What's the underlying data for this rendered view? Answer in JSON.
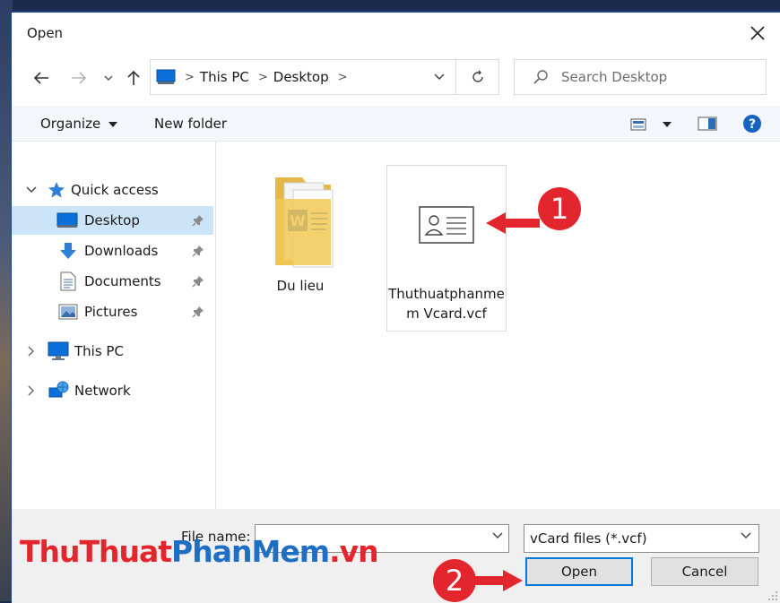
{
  "window": {
    "title": "Open"
  },
  "address": {
    "segments": [
      "This PC",
      "Desktop"
    ]
  },
  "search": {
    "placeholder": "Search Desktop"
  },
  "toolbar": {
    "organize_label": "Organize",
    "new_folder_label": "New folder"
  },
  "sidebar": {
    "quick_access_label": "Quick access",
    "items": [
      {
        "label": "Desktop",
        "icon": "desktop-icon",
        "selected": true
      },
      {
        "label": "Downloads",
        "icon": "download-icon"
      },
      {
        "label": "Documents",
        "icon": "documents-icon"
      },
      {
        "label": "Pictures",
        "icon": "pictures-icon"
      }
    ],
    "this_pc_label": "This PC",
    "network_label": "Network"
  },
  "files": [
    {
      "name": "Du lieu",
      "type": "folder"
    },
    {
      "name": "Thuthuatphanmem Vcard.vcf",
      "name_line1": "Thuthuatphanme",
      "name_line2": "m Vcard.vcf",
      "type": "vcf",
      "selected": true
    }
  ],
  "bottom": {
    "file_name_label": "File name:",
    "file_name_value": "",
    "file_type_value": "vCard files (*.vcf)",
    "open_label": "Open",
    "cancel_label": "Cancel"
  },
  "annotations": {
    "badge1": "1",
    "badge2": "2",
    "color": "#e3262d"
  },
  "watermark": {
    "part1": "ThuThuat",
    "part2": "PhanMem",
    "part3": ".vn"
  }
}
